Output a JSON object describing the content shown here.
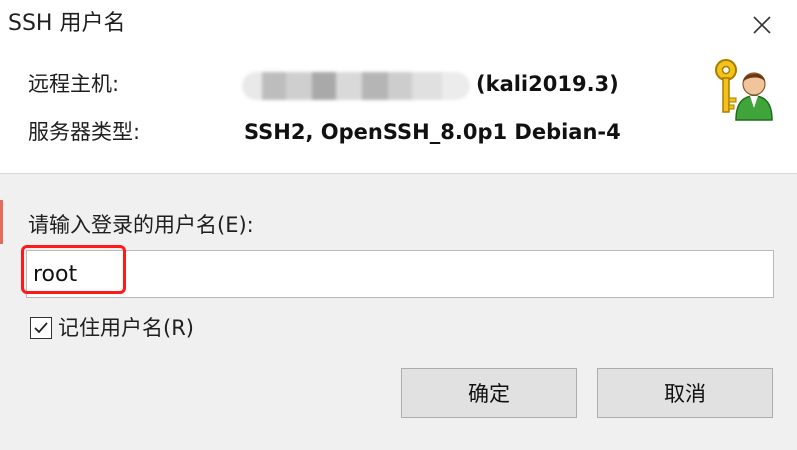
{
  "window": {
    "title": "SSH 用户名",
    "close_glyph": "✕"
  },
  "info": {
    "host_label": "远程主机:",
    "host_value": "(kali2019.3)",
    "server_type_label": "服务器类型:",
    "server_type_value": "SSH2, OpenSSH_8.0p1 Debian-4"
  },
  "form": {
    "prompt_label": "请输入登录的用户名(E):",
    "username_value": "root",
    "remember_label": "记住用户名(R)",
    "remember_checked": true
  },
  "buttons": {
    "ok_label": "确定",
    "cancel_label": "取消"
  },
  "icons": {
    "user_key": "user-key-icon",
    "close": "close-icon",
    "check": "check-icon"
  },
  "colors": {
    "highlight": "#ff1a1a",
    "panel_bg": "#ffffff",
    "dialog_bg": "#f0f0f0",
    "button_bg": "#e1e1e1"
  }
}
